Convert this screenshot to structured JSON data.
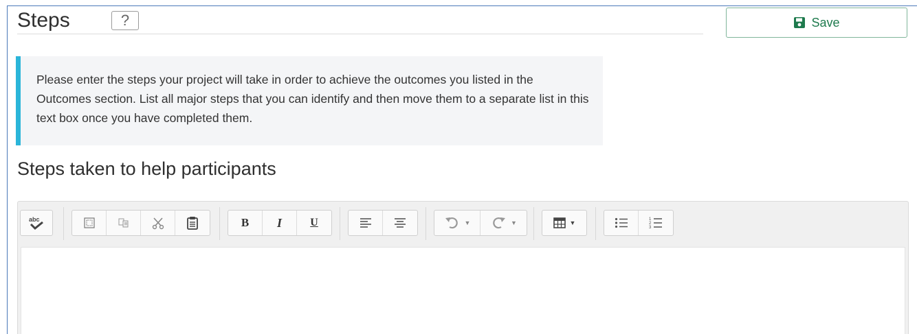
{
  "header": {
    "title": "Steps",
    "help_label": "?"
  },
  "save_button": {
    "label": "Save",
    "icon": "floppy-disk-icon",
    "color": "#1e7a4d"
  },
  "info": {
    "text": "Please enter the steps your project will take in order to achieve the outcomes you listed in the Outcomes section. List all major steps that you can identify and then move them to a separate list in this text box once you have completed them.",
    "accent_color": "#2bb5d9"
  },
  "field": {
    "label": "Steps taken to help participants",
    "value": ""
  },
  "toolbar": {
    "spellcheck": "spellcheck-icon",
    "clipboard": [
      "maximize-icon",
      "copy-icon",
      "cut-icon",
      "paste-icon"
    ],
    "format": {
      "bold": "B",
      "italic": "I",
      "underline": "U"
    },
    "align": [
      "align-left-icon",
      "align-center-icon"
    ],
    "history": [
      "undo-icon",
      "redo-icon"
    ],
    "insert": [
      "table-icon"
    ],
    "lists": [
      "bullet-list-icon",
      "numbered-list-icon"
    ]
  }
}
